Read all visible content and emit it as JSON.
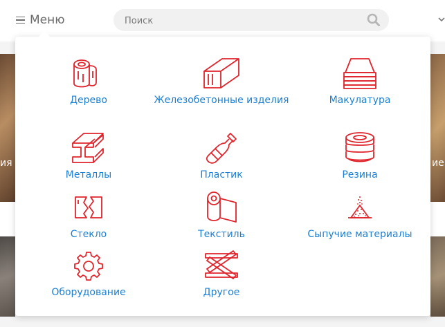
{
  "header": {
    "menu_label": "Меню",
    "search_placeholder": "Поиск"
  },
  "background": {
    "left_text": "ия",
    "right_text": "ие"
  },
  "colors": {
    "icon_red": "#e0242c",
    "link_blue": "#1a7fd4"
  },
  "categories": [
    {
      "label": "Дерево",
      "icon": "log-icon"
    },
    {
      "label": "Железобетонные изделия",
      "icon": "concrete-block-icon"
    },
    {
      "label": "Макулатура",
      "icon": "paper-stack-icon"
    },
    {
      "label": "Металлы",
      "icon": "metal-beam-icon"
    },
    {
      "label": "Пластик",
      "icon": "plastic-bottle-icon"
    },
    {
      "label": "Резина",
      "icon": "tires-icon"
    },
    {
      "label": "Стекло",
      "icon": "broken-glass-icon"
    },
    {
      "label": "Текстиль",
      "icon": "fabric-roll-icon"
    },
    {
      "label": "Сыпучие материалы",
      "icon": "sand-pile-icon"
    },
    {
      "label": "Оборудование",
      "icon": "gear-icon"
    },
    {
      "label": "Другое",
      "icon": "crossed-planks-icon"
    }
  ]
}
